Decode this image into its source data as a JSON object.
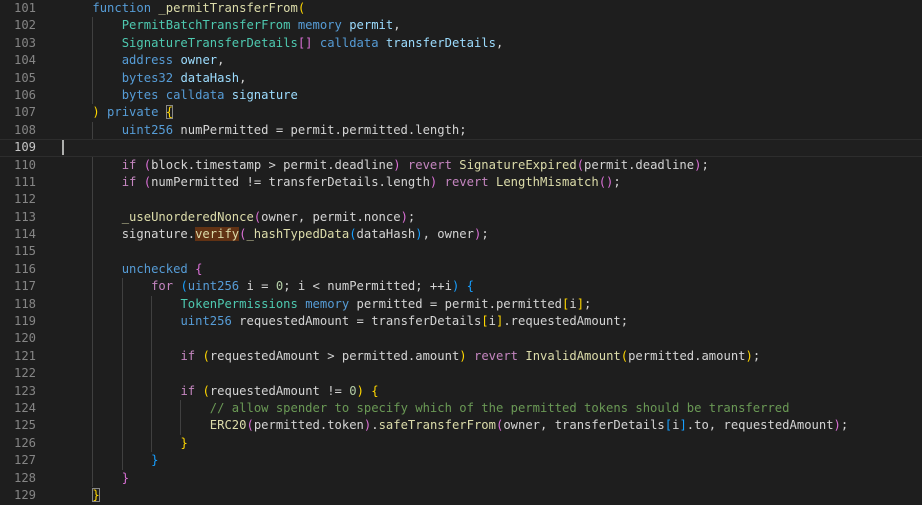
{
  "editor": {
    "cursor_line": 109,
    "colors": {
      "background": "#1e1e1e",
      "line_number": "#858585",
      "keyword": "#569cd6",
      "control": "#c586c0",
      "function": "#dcdcaa",
      "type": "#4ec9b0",
      "variable": "#9cdcfe",
      "number": "#b5cea8",
      "comment": "#6a9955",
      "bracket_1": "#ffd700",
      "bracket_2": "#da70d6",
      "bracket_3": "#179fff",
      "find_highlight": "#613214"
    },
    "lines": [
      {
        "n": 101,
        "indent": 1,
        "tokens": [
          [
            "kw",
            "function"
          ],
          [
            "txt",
            " "
          ],
          [
            "fn",
            "_permitTransferFrom"
          ],
          [
            "b1",
            "("
          ]
        ]
      },
      {
        "n": 102,
        "indent": 2,
        "tokens": [
          [
            "type",
            "PermitBatchTransferFrom"
          ],
          [
            "txt",
            " "
          ],
          [
            "kw",
            "memory"
          ],
          [
            "txt",
            " "
          ],
          [
            "var",
            "permit"
          ],
          [
            "txt",
            ","
          ]
        ]
      },
      {
        "n": 103,
        "indent": 2,
        "tokens": [
          [
            "type",
            "SignatureTransferDetails"
          ],
          [
            "b2",
            "[]"
          ],
          [
            "txt",
            " "
          ],
          [
            "kw",
            "calldata"
          ],
          [
            "txt",
            " "
          ],
          [
            "var",
            "transferDetails"
          ],
          [
            "txt",
            ","
          ]
        ]
      },
      {
        "n": 104,
        "indent": 2,
        "tokens": [
          [
            "kw",
            "address"
          ],
          [
            "txt",
            " "
          ],
          [
            "var",
            "owner"
          ],
          [
            "txt",
            ","
          ]
        ]
      },
      {
        "n": 105,
        "indent": 2,
        "tokens": [
          [
            "kw",
            "bytes32"
          ],
          [
            "txt",
            " "
          ],
          [
            "var",
            "dataHash"
          ],
          [
            "txt",
            ","
          ]
        ]
      },
      {
        "n": 106,
        "indent": 2,
        "tokens": [
          [
            "kw",
            "bytes"
          ],
          [
            "txt",
            " "
          ],
          [
            "kw",
            "calldata"
          ],
          [
            "txt",
            " "
          ],
          [
            "var",
            "signature"
          ]
        ]
      },
      {
        "n": 107,
        "indent": 1,
        "tokens": [
          [
            "b1",
            ")"
          ],
          [
            "txt",
            " "
          ],
          [
            "kw",
            "private"
          ],
          [
            "txt",
            " "
          ],
          [
            "b1bm",
            "{"
          ]
        ]
      },
      {
        "n": 108,
        "indent": 2,
        "tokens": [
          [
            "kw",
            "uint256"
          ],
          [
            "txt",
            " numPermitted = permit.permitted.length;"
          ]
        ]
      },
      {
        "n": 109,
        "indent": 0,
        "tokens": []
      },
      {
        "n": 110,
        "indent": 2,
        "tokens": [
          [
            "ctl",
            "if"
          ],
          [
            "txt",
            " "
          ],
          [
            "b2",
            "("
          ],
          [
            "txt",
            "block.timestamp > permit.deadline"
          ],
          [
            "b2",
            ")"
          ],
          [
            "txt",
            " "
          ],
          [
            "ctl",
            "revert"
          ],
          [
            "txt",
            " "
          ],
          [
            "fn",
            "SignatureExpired"
          ],
          [
            "b2",
            "("
          ],
          [
            "txt",
            "permit.deadline"
          ],
          [
            "b2",
            ")"
          ],
          [
            "txt",
            ";"
          ]
        ]
      },
      {
        "n": 111,
        "indent": 2,
        "tokens": [
          [
            "ctl",
            "if"
          ],
          [
            "txt",
            " "
          ],
          [
            "b2",
            "("
          ],
          [
            "txt",
            "numPermitted != transferDetails.length"
          ],
          [
            "b2",
            ")"
          ],
          [
            "txt",
            " "
          ],
          [
            "ctl",
            "revert"
          ],
          [
            "txt",
            " "
          ],
          [
            "fn",
            "LengthMismatch"
          ],
          [
            "b2",
            "()"
          ],
          [
            "txt",
            ";"
          ]
        ]
      },
      {
        "n": 112,
        "indent": 2,
        "tokens": []
      },
      {
        "n": 113,
        "indent": 2,
        "tokens": [
          [
            "fn",
            "_useUnorderedNonce"
          ],
          [
            "b2",
            "("
          ],
          [
            "txt",
            "owner, permit.nonce"
          ],
          [
            "b2",
            ")"
          ],
          [
            "txt",
            ";"
          ]
        ]
      },
      {
        "n": 114,
        "indent": 2,
        "tokens": [
          [
            "txt",
            "signature."
          ],
          [
            "fnhl",
            "verify"
          ],
          [
            "b2",
            "("
          ],
          [
            "fn",
            "_hashTypedData"
          ],
          [
            "b3",
            "("
          ],
          [
            "txt",
            "dataHash"
          ],
          [
            "b3",
            ")"
          ],
          [
            "txt",
            ", owner"
          ],
          [
            "b2",
            ")"
          ],
          [
            "txt",
            ";"
          ]
        ]
      },
      {
        "n": 115,
        "indent": 2,
        "tokens": []
      },
      {
        "n": 116,
        "indent": 2,
        "tokens": [
          [
            "kw",
            "unchecked"
          ],
          [
            "txt",
            " "
          ],
          [
            "b2",
            "{"
          ]
        ]
      },
      {
        "n": 117,
        "indent": 3,
        "tokens": [
          [
            "ctl",
            "for"
          ],
          [
            "txt",
            " "
          ],
          [
            "b3",
            "("
          ],
          [
            "kw",
            "uint256"
          ],
          [
            "txt",
            " i = "
          ],
          [
            "num",
            "0"
          ],
          [
            "txt",
            "; i < numPermitted; ++i"
          ],
          [
            "b3",
            ")"
          ],
          [
            "txt",
            " "
          ],
          [
            "b3",
            "{"
          ]
        ]
      },
      {
        "n": 118,
        "indent": 4,
        "tokens": [
          [
            "type",
            "TokenPermissions"
          ],
          [
            "txt",
            " "
          ],
          [
            "kw",
            "memory"
          ],
          [
            "txt",
            " permitted = permit.permitted"
          ],
          [
            "b1",
            "["
          ],
          [
            "txt",
            "i"
          ],
          [
            "b1",
            "]"
          ],
          [
            "txt",
            ";"
          ]
        ]
      },
      {
        "n": 119,
        "indent": 4,
        "tokens": [
          [
            "kw",
            "uint256"
          ],
          [
            "txt",
            " requestedAmount = transferDetails"
          ],
          [
            "b1",
            "["
          ],
          [
            "txt",
            "i"
          ],
          [
            "b1",
            "]"
          ],
          [
            "txt",
            ".requestedAmount;"
          ]
        ]
      },
      {
        "n": 120,
        "indent": 4,
        "tokens": []
      },
      {
        "n": 121,
        "indent": 4,
        "tokens": [
          [
            "ctl",
            "if"
          ],
          [
            "txt",
            " "
          ],
          [
            "b1",
            "("
          ],
          [
            "txt",
            "requestedAmount > permitted.amount"
          ],
          [
            "b1",
            ")"
          ],
          [
            "txt",
            " "
          ],
          [
            "ctl",
            "revert"
          ],
          [
            "txt",
            " "
          ],
          [
            "fn",
            "InvalidAmount"
          ],
          [
            "b1",
            "("
          ],
          [
            "txt",
            "permitted.amount"
          ],
          [
            "b1",
            ")"
          ],
          [
            "txt",
            ";"
          ]
        ]
      },
      {
        "n": 122,
        "indent": 4,
        "tokens": []
      },
      {
        "n": 123,
        "indent": 4,
        "tokens": [
          [
            "ctl",
            "if"
          ],
          [
            "txt",
            " "
          ],
          [
            "b1",
            "("
          ],
          [
            "txt",
            "requestedAmount != "
          ],
          [
            "num",
            "0"
          ],
          [
            "b1",
            ")"
          ],
          [
            "txt",
            " "
          ],
          [
            "b1",
            "{"
          ]
        ]
      },
      {
        "n": 124,
        "indent": 5,
        "tokens": [
          [
            "cmt",
            "// allow spender to specify which of the permitted tokens should be transferred"
          ]
        ]
      },
      {
        "n": 125,
        "indent": 5,
        "tokens": [
          [
            "fn",
            "ERC20"
          ],
          [
            "b2",
            "("
          ],
          [
            "txt",
            "permitted.token"
          ],
          [
            "b2",
            ")"
          ],
          [
            "txt",
            "."
          ],
          [
            "fn",
            "safeTransferFrom"
          ],
          [
            "b2",
            "("
          ],
          [
            "txt",
            "owner, transferDetails"
          ],
          [
            "b3",
            "["
          ],
          [
            "txt",
            "i"
          ],
          [
            "b3",
            "]"
          ],
          [
            "txt",
            ".to, requestedAmount"
          ],
          [
            "b2",
            ")"
          ],
          [
            "txt",
            ";"
          ]
        ]
      },
      {
        "n": 126,
        "indent": 4,
        "tokens": [
          [
            "b1",
            "}"
          ]
        ]
      },
      {
        "n": 127,
        "indent": 3,
        "tokens": [
          [
            "b3",
            "}"
          ]
        ]
      },
      {
        "n": 128,
        "indent": 2,
        "tokens": [
          [
            "b2",
            "}"
          ]
        ]
      },
      {
        "n": 129,
        "indent": 1,
        "tokens": [
          [
            "b1bm",
            "}"
          ]
        ]
      }
    ]
  }
}
